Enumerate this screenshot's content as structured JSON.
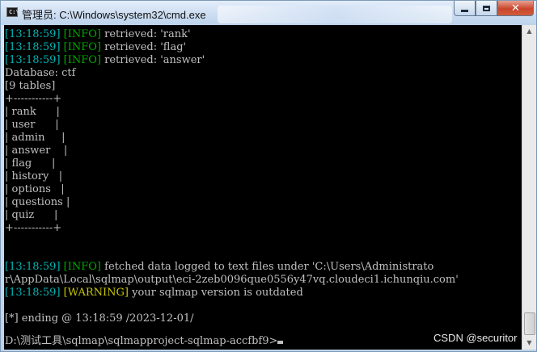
{
  "window": {
    "title": "管理员: C:\\Windows\\system32\\cmd.exe",
    "app_icon_text": "C:\\",
    "controls": {
      "minimize": "minimize-icon",
      "maximize": "maximize-icon",
      "close": "✕"
    }
  },
  "console": {
    "lines": [
      {
        "ts": "[13:18:59]",
        "level": "[INFO]",
        "level_type": "info",
        "msg": " retrieved: 'rank'"
      },
      {
        "ts": "[13:18:59]",
        "level": "[INFO]",
        "level_type": "info",
        "msg": " retrieved: 'flag'"
      },
      {
        "ts": "[13:18:59]",
        "level": "[INFO]",
        "level_type": "info",
        "msg": " retrieved: 'answer'"
      },
      {
        "text": "Database: ctf"
      },
      {
        "text": "[9 tables]"
      },
      {
        "text": "+-----------+"
      },
      {
        "text": "| rank      |"
      },
      {
        "text": "| user      |"
      },
      {
        "text": "| admin     |"
      },
      {
        "text": "| answer    |"
      },
      {
        "text": "| flag      |"
      },
      {
        "text": "| history   |"
      },
      {
        "text": "| options   |"
      },
      {
        "text": "| questions |"
      },
      {
        "text": "| quiz      |"
      },
      {
        "text": "+-----------+"
      },
      {
        "text": ""
      },
      {
        "text": ""
      },
      {
        "ts": "[13:18:59]",
        "level": "[INFO]",
        "level_type": "info",
        "msg": " fetched data logged to text files under 'C:\\Users\\Administrato"
      },
      {
        "text": "r\\AppData\\Local\\sqlmap\\output\\eci-2zeb0096que0556y47vq.cloudeci1.ichunqiu.com'"
      },
      {
        "ts": "[13:18:59]",
        "level": "[WARNING]",
        "level_type": "warn",
        "msg": " your sqlmap version is outdated"
      },
      {
        "text": ""
      },
      {
        "text": "[*] ending @ 13:18:59 /2023-12-01/"
      }
    ],
    "prompt": "D:\\测试工具\\sqlmap\\sqlmapproject-sqlmap-accfbf9>"
  },
  "scrollbar": {
    "up": "▲",
    "down": "▼"
  },
  "watermark": "CSDN @securitor",
  "colors": {
    "timestamp": "#00b4b4",
    "info": "#00a800",
    "warning": "#c8c800",
    "text": "#c0c0c0",
    "background": "#000000"
  }
}
